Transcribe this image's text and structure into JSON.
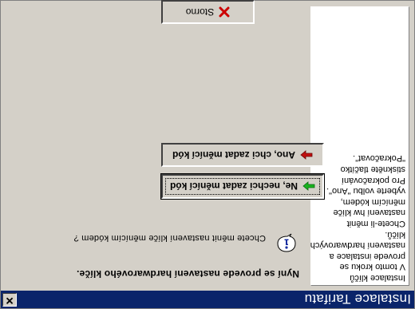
{
  "window": {
    "title": "Instalace Tarifatu",
    "close_symbol": "✕"
  },
  "sidebar": {
    "lines": [
      "Instalace klíčů",
      "V tomto kroku se",
      "provede instalace a",
      "nastavení hardwarových",
      "klíčů.",
      "Chcete-li měnit",
      "nastavení hw klíče",
      "měnícím kódem,",
      "vyberte volbu \"Ano\".",
      "Pro pokračování",
      "stiskněte tlačítko",
      "\"Pokračovat\"."
    ]
  },
  "main": {
    "heading": "Nyní se provede nastavení hardwarového klíče.",
    "question": "Chcete měnit nastavení klíče měnícím kódem ?"
  },
  "buttons": {
    "no_label": "Ne, nechci zadat měnící kód",
    "yes_label": "Ano, chci zadat měnící kód",
    "cancel_label": "Storno"
  },
  "icons": {
    "info": "info-icon",
    "green_arrow": "arrow-right-icon",
    "red_arrow": "arrow-right-icon",
    "cancel_x": "close-icon"
  },
  "colors": {
    "titlebar": "#0a246a",
    "green_arrow": "#19b31f",
    "red_arrow": "#c01010",
    "cancel_x": "#cc0000",
    "info_blue": "#1a2fa0"
  }
}
